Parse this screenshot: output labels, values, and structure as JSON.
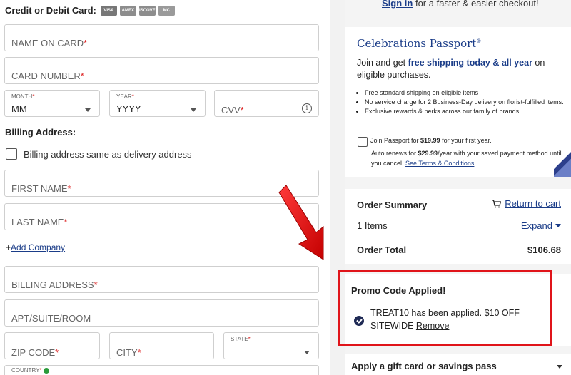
{
  "payment": {
    "card_title": "Credit or Debit Card:",
    "card_logos": [
      "VISA",
      "AMEX",
      "DISCOVER",
      "MC"
    ]
  },
  "fields": {
    "name_on_card": "NAME ON CARD",
    "card_number": "CARD NUMBER",
    "month_label": "MONTH",
    "month_value": "MM",
    "year_label": "YEAR",
    "year_value": "YYYY",
    "cvv": "CVV",
    "required_mark": "*"
  },
  "billing": {
    "title": "Billing Address:",
    "same_as_delivery": "Billing address same as delivery address",
    "first_name": "FIRST NAME",
    "last_name": "LAST NAME",
    "add_company_prefix": "+",
    "add_company": "Add Company",
    "billing_address": "BILLING ADDRESS",
    "apt": "APT/SUITE/ROOM",
    "zip": "ZIP CODE",
    "city": "CITY",
    "state_label": "STATE",
    "country_label": "COUNTRY"
  },
  "signin": {
    "link": "Sign in",
    "rest": " for a faster & easier checkout!"
  },
  "passport": {
    "title": "Celebrations Passport",
    "title_mark": "®",
    "intro_1": "Join and get ",
    "intro_hl": "free shipping today & all year",
    "intro_2": " on eligible purchases.",
    "bullets": [
      "Free standard shipping on eligible items",
      "No service charge for 2 Business-Day delivery on florist-fulfilled items.",
      "Exclusive rewards & perks across our family of brands"
    ],
    "join_1": "Join Passport for ",
    "join_price": "$19.99",
    "join_2": " for your first year.",
    "renew_1": "Auto renews for ",
    "renew_price": "$29.99",
    "renew_2": "/year with your saved payment method until you cancel. ",
    "terms": "See Terms & Conditions"
  },
  "order": {
    "title": "Order Summary",
    "return_to_cart": "Return to cart",
    "items": "1 Items",
    "expand": "Expand",
    "total_label": "Order Total",
    "total_value": "$106.68"
  },
  "promo": {
    "title": "Promo Code Applied!",
    "message": "TREAT10 has been applied. $10 OFF SITEWIDE ",
    "remove": "Remove"
  },
  "gift": {
    "title": "Apply a gift card or savings pass"
  },
  "colors": {
    "brand": "#1a3c88",
    "required": "#dd2222",
    "highlight": "#e0141a"
  }
}
